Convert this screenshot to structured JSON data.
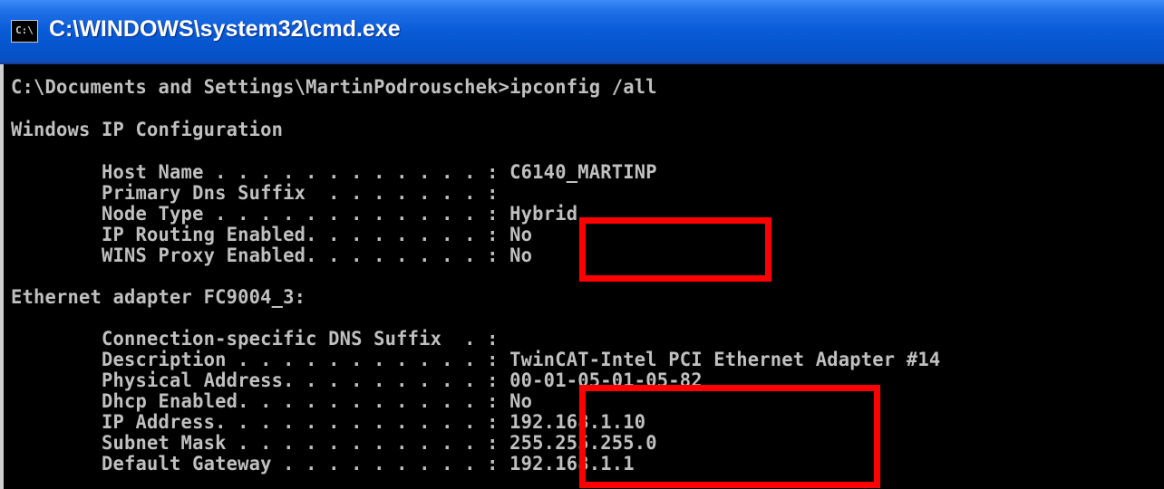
{
  "window": {
    "title": "C:\\WINDOWS\\system32\\cmd.exe",
    "icon_text": "C:\\"
  },
  "console": {
    "prompt": "C:\\Documents and Settings\\MartinPodrouschek>ipconfig /all",
    "header": "Windows IP Configuration",
    "host_name": "        Host Name . . . . . . . . . . . . : C6140_MARTINP",
    "primary_dns": "        Primary Dns Suffix  . . . . . . . :",
    "node_type": "        Node Type . . . . . . . . . . . . : Hybrid",
    "ip_routing": "        IP Routing Enabled. . . . . . . . : No",
    "wins_proxy": "        WINS Proxy Enabled. . . . . . . . : No",
    "adapter_header": "Ethernet adapter FC9004_3:",
    "conn_dns": "        Connection-specific DNS Suffix  . :",
    "description": "        Description . . . . . . . . . . . : TwinCAT-Intel PCI Ethernet Adapter #14",
    "physical": "        Physical Address. . . . . . . . . : 00-01-05-01-05-82",
    "dhcp": "        Dhcp Enabled. . . . . . . . . . . : No",
    "ip": "        IP Address. . . . . . . . . . . . : 192.168.1.10",
    "subnet": "        Subnet Mask . . . . . . . . . . . : 255.255.255.0",
    "gateway": "        Default Gateway . . . . . . . . . : 192.168.1.1"
  },
  "colors": {
    "highlight": "#ff0000",
    "console_text": "#c0c0c0",
    "titlebar": "#0a5bd8"
  }
}
